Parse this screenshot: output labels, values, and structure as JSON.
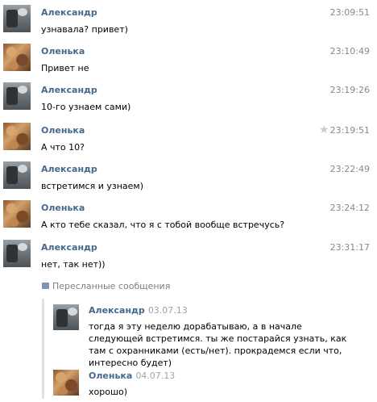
{
  "messages": [
    {
      "author": "Александр",
      "time": "23:09:51",
      "text": "узнавала? привет)",
      "avatar": "alexandr-avatar"
    },
    {
      "author": "Оленька",
      "time": "23:10:49",
      "text": "Привет не",
      "avatar": "olenka-avatar"
    },
    {
      "author": "Александр",
      "time": "23:19:26",
      "text": "10-го узнаем сами)",
      "avatar": "alexandr-avatar"
    },
    {
      "author": "Оленька",
      "time": "23:19:51",
      "text": "А что 10?",
      "avatar": "olenka-avatar",
      "starred": true
    },
    {
      "author": "Александр",
      "time": "23:22:49",
      "text": "встретимся и узнаем)",
      "avatar": "alexandr-avatar"
    },
    {
      "author": "Оленька",
      "time": "23:24:12",
      "text": "А кто тебе сказал, что я с тобой вообще встречусь?",
      "avatar": "olenka-avatar"
    },
    {
      "author": "Александр",
      "time": "23:31:17",
      "text": "нет, так нет))",
      "avatar": "alexandr-avatar"
    }
  ],
  "forwarded": {
    "label": "Пересланные сообщения",
    "items": [
      {
        "author": "Александр",
        "date": "03.07.13",
        "text": "тогда я эту неделю дорабатываю, а в начале следующей встретимся. ты же постарайся узнать, как там с охранниками (есть/нет). прокрадемся если что, интересно будет)"
      },
      {
        "author": "Оленька",
        "date": "04.07.13",
        "text": "хорошо)"
      }
    ]
  },
  "colors": {
    "name": "#45688e",
    "time": "#888888",
    "background": "#ffffff",
    "accent_bar": "#dae1e8"
  },
  "icons": {
    "star": "star-icon",
    "forward": "forward-icon"
  }
}
